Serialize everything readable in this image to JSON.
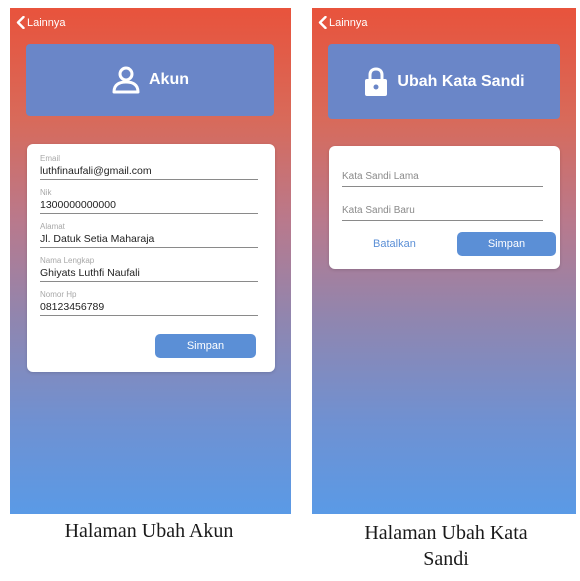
{
  "left_screen": {
    "back_label": "Lainnya",
    "header_title": "Akun",
    "fields": [
      {
        "label": "Email",
        "value": "luthfinaufali@gmail.com"
      },
      {
        "label": "Nik",
        "value": "1300000000000"
      },
      {
        "label": "Alamat",
        "value": "Jl. Datuk Setia Maharaja"
      },
      {
        "label": "Nama Lengkap",
        "value": "Ghiyats Luthfi Naufali"
      },
      {
        "label": "Nomor Hp",
        "value": "08123456789"
      }
    ],
    "save_label": "Simpan",
    "caption": "Halaman Ubah Akun"
  },
  "right_screen": {
    "back_label": "Lainnya",
    "header_title": "Ubah Kata Sandi",
    "old_password_placeholder": "Kata Sandi Lama",
    "new_password_placeholder": "Kata Sandi Baru",
    "cancel_label": "Batalkan",
    "save_label": "Simpan",
    "caption_line1": "Halaman Ubah Kata",
    "caption_line2": "Sandi"
  },
  "colors": {
    "header_card": "#6a86c8",
    "primary_button": "#5b8fd6",
    "gradient_top": "#e8533c",
    "gradient_bottom": "#5a9ae6"
  },
  "icons": {
    "back": "chevron-left-icon",
    "account": "user-icon",
    "password": "lock-icon"
  }
}
